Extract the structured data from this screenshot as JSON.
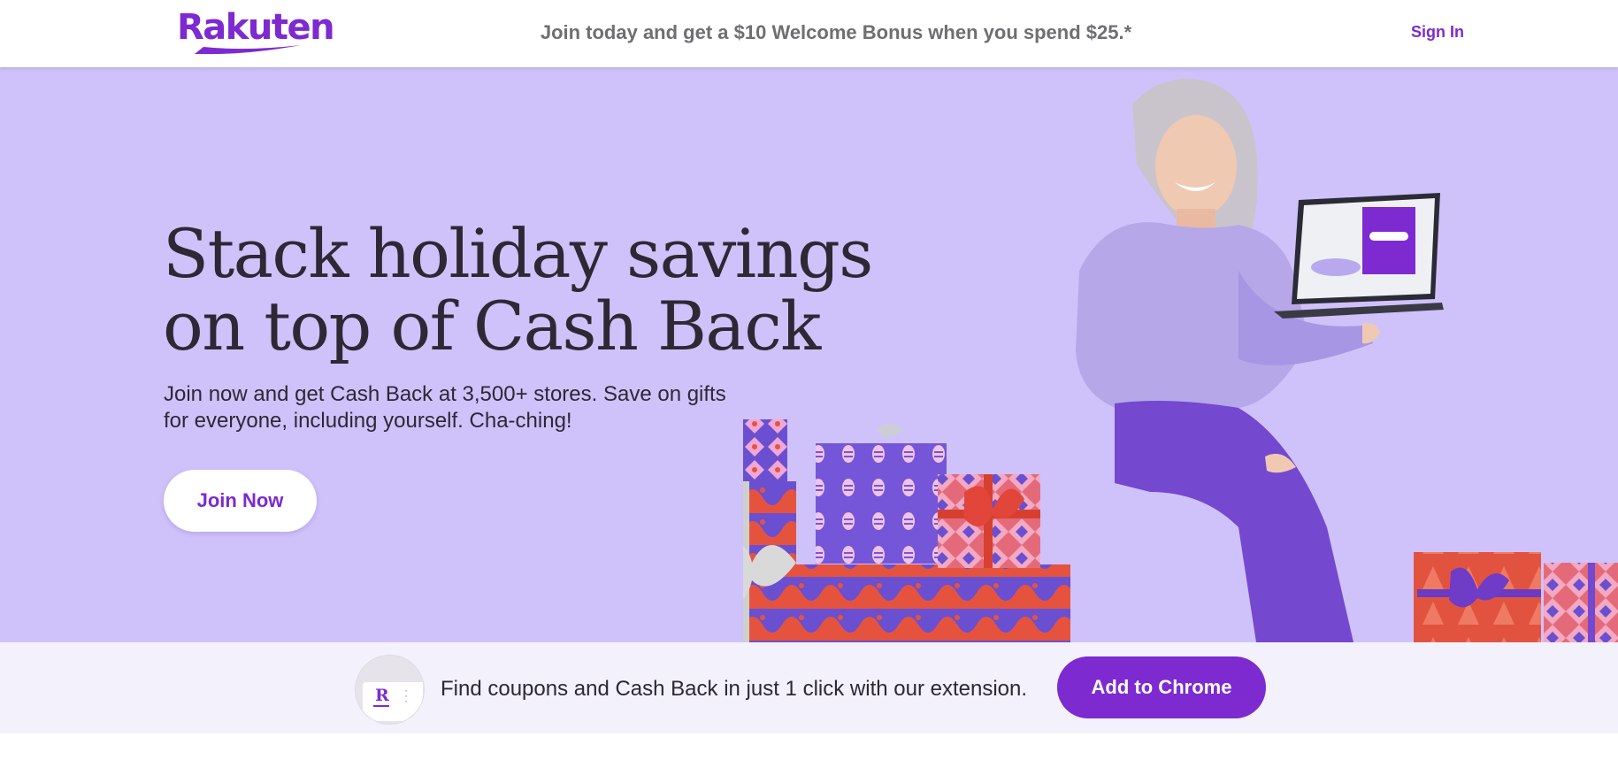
{
  "header": {
    "logo_text": "Rakuten",
    "promo": "Join today and get a $10 Welcome Bonus when you spend $25.*",
    "sign_in_label": "Sign In"
  },
  "hero": {
    "headline_line1": "Stack holiday savings",
    "headline_line2": "on top of Cash Back",
    "subcopy_line1": "Join now and get Cash Back at 3,500+ stores. Save on gifts",
    "subcopy_line2": "for everyone, including yourself. Cha-ching!",
    "cta_label": "Join Now",
    "background_color": "#cfc2fb"
  },
  "extension_bar": {
    "icon_letter": "R",
    "text": "Find coupons and Cash Back in just 1 click with our extension.",
    "cta_label": "Add to Chrome",
    "background_color": "#f3f1fb"
  },
  "colors": {
    "brand_purple": "#7d2ad0",
    "text_dark": "#2d2833",
    "promo_gray": "#6f6e72"
  }
}
